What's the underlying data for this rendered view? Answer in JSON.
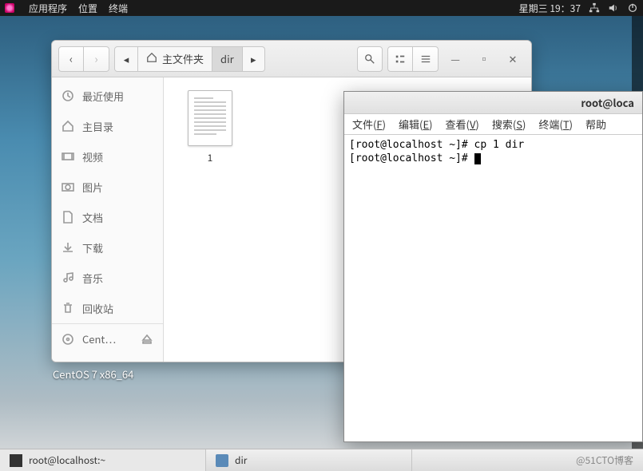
{
  "top_panel": {
    "apps": "应用程序",
    "places": "位置",
    "terminal": "终端",
    "clock": "星期三 19：37"
  },
  "file_manager": {
    "path_home": "主文件夹",
    "path_dir": "dir",
    "sidebar": [
      {
        "icon": "clock",
        "label": "最近使用"
      },
      {
        "icon": "home",
        "label": "主目录"
      },
      {
        "icon": "video",
        "label": "视频"
      },
      {
        "icon": "camera",
        "label": "图片"
      },
      {
        "icon": "doc",
        "label": "文档"
      },
      {
        "icon": "down",
        "label": "下载"
      },
      {
        "icon": "music",
        "label": "音乐"
      },
      {
        "icon": "trash",
        "label": "回收站"
      },
      {
        "icon": "disc",
        "label": "Cent…"
      }
    ],
    "files": [
      {
        "name": "1"
      }
    ]
  },
  "desktop_label": "CentOS 7 x86_64",
  "terminal": {
    "title": "root@loca",
    "menu": {
      "file": "文件",
      "edit": "编辑",
      "view": "查看",
      "search": "搜索",
      "term": "终端",
      "help": "帮助"
    },
    "menu_keys": {
      "file": "F",
      "edit": "E",
      "view": "V",
      "search": "S",
      "term": "T"
    },
    "line1": "[root@localhost ~]# cp 1 dir",
    "line2": "[root@localhost ~]# "
  },
  "taskbar": {
    "task1": "root@localhost:~",
    "task2": "dir",
    "watermark": "@51CTO博客"
  }
}
